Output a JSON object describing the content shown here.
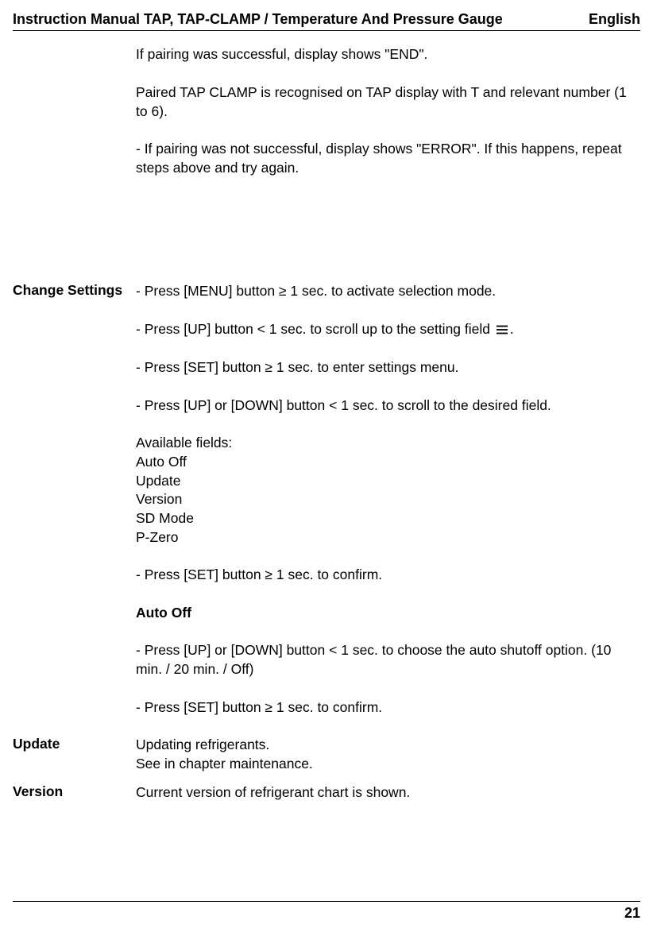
{
  "header": {
    "title": "Instruction Manual TAP, TAP-CLAMP / Temperature And Pressure Gauge",
    "lang": "English"
  },
  "section_intro": {
    "p1": "If pairing was successful, display shows \"END\".",
    "p2": "Paired TAP CLAMP is recognised on TAP display with T and relevant number (1 to 6).",
    "p3": "- If pairing was not successful, display shows \"ERROR\". If this happens, repeat steps above and try again."
  },
  "section_change": {
    "label": "Change Settings",
    "p1a": "- Press [MENU] button ",
    "p1b": " 1 sec. to activate selection mode.",
    "p2a": "- Press [UP] button ",
    "p2b": " 1 sec. to scroll up to the setting field ",
    "p2c": ".",
    "p3a": "- Press [SET] button ",
    "p3b": " 1 sec. to enter settings menu.",
    "p4a": "- Press [UP] or [DOWN] button ",
    "p4b": " 1 sec. to scroll to the desired field.",
    "fields_label": "Available fields:",
    "f1": "Auto Off",
    "f2": "Update",
    "f3": "Version",
    "f4": "SD Mode",
    "f5": "P-Zero",
    "p5a": "- Press [SET] button ",
    "p5b": " 1 sec. to confirm.",
    "auto_off_heading": "Auto Off",
    "p6a": "- Press [UP] or [DOWN] button ",
    "p6b": " 1 sec. to choose the auto shutoff option. (10 min. / 20 min. / Off)",
    "p7a": "- Press [SET] button ",
    "p7b": " 1 sec. to confirm."
  },
  "section_update": {
    "label": "Update",
    "line1": "Updating refrigerants.",
    "line2": "See in chapter maintenance."
  },
  "section_version": {
    "label": "Version",
    "line1": "Current version of refrigerant chart is shown."
  },
  "symbols": {
    "ge": "≥",
    "lt": "<"
  },
  "page_number": "21"
}
